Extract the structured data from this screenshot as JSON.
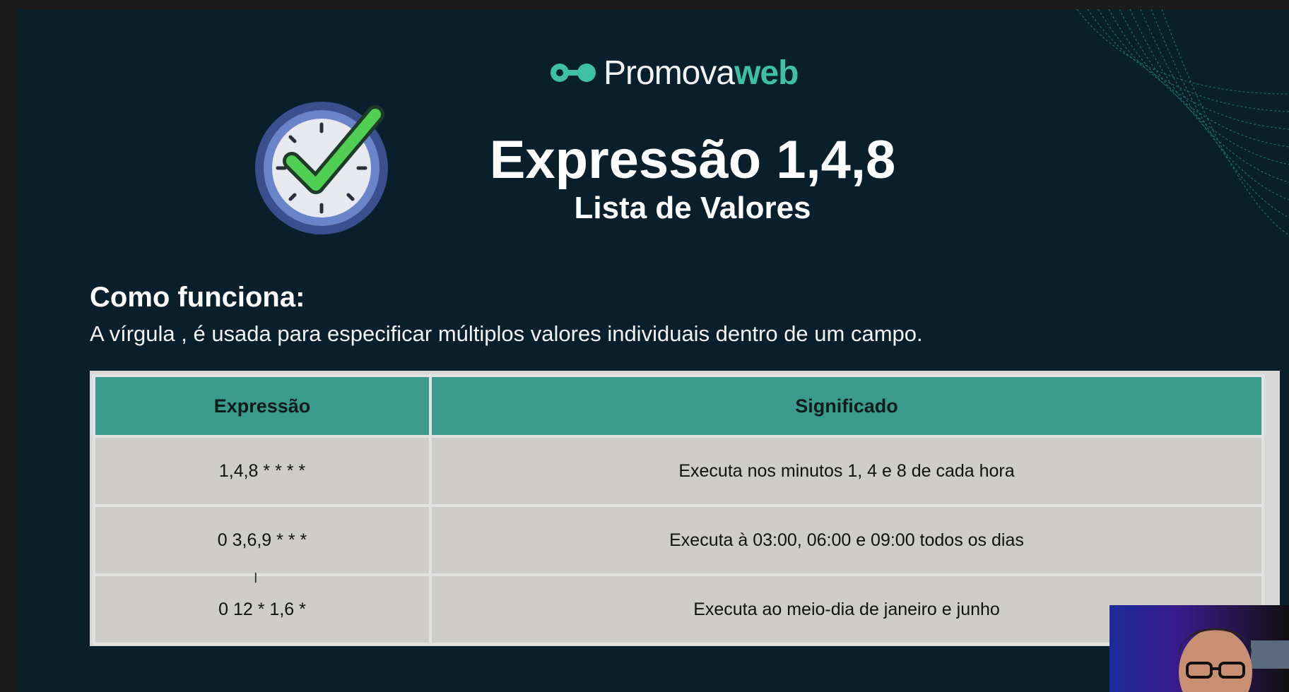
{
  "logo": {
    "text_main": "Promova",
    "text_accent": "web"
  },
  "title": "Expressão 1,4,8",
  "subtitle": "Lista de Valores",
  "how": {
    "heading": "Como funciona:",
    "description": "A vírgula , é usada para especificar múltiplos valores individuais dentro de um campo."
  },
  "table": {
    "headers": [
      "Expressão",
      "Significado"
    ],
    "rows": [
      [
        "1,4,8 * * * *",
        "Executa nos minutos 1, 4 e 8 de cada hora"
      ],
      [
        "0 3,6,9 * * *",
        "Executa à 03:00, 06:00 e 09:00 todos os dias"
      ],
      [
        "0 12 * 1,6 *",
        "Executa ao meio-dia de janeiro e junho"
      ]
    ]
  },
  "colors": {
    "background": "#0a1f2c",
    "accent": "#3ec0a4",
    "table_header": "#3a9b8d",
    "table_cell": "#cfcdca"
  },
  "icons": [
    "clock-check-icon",
    "logo-mark-icon",
    "text-cursor-icon"
  ]
}
